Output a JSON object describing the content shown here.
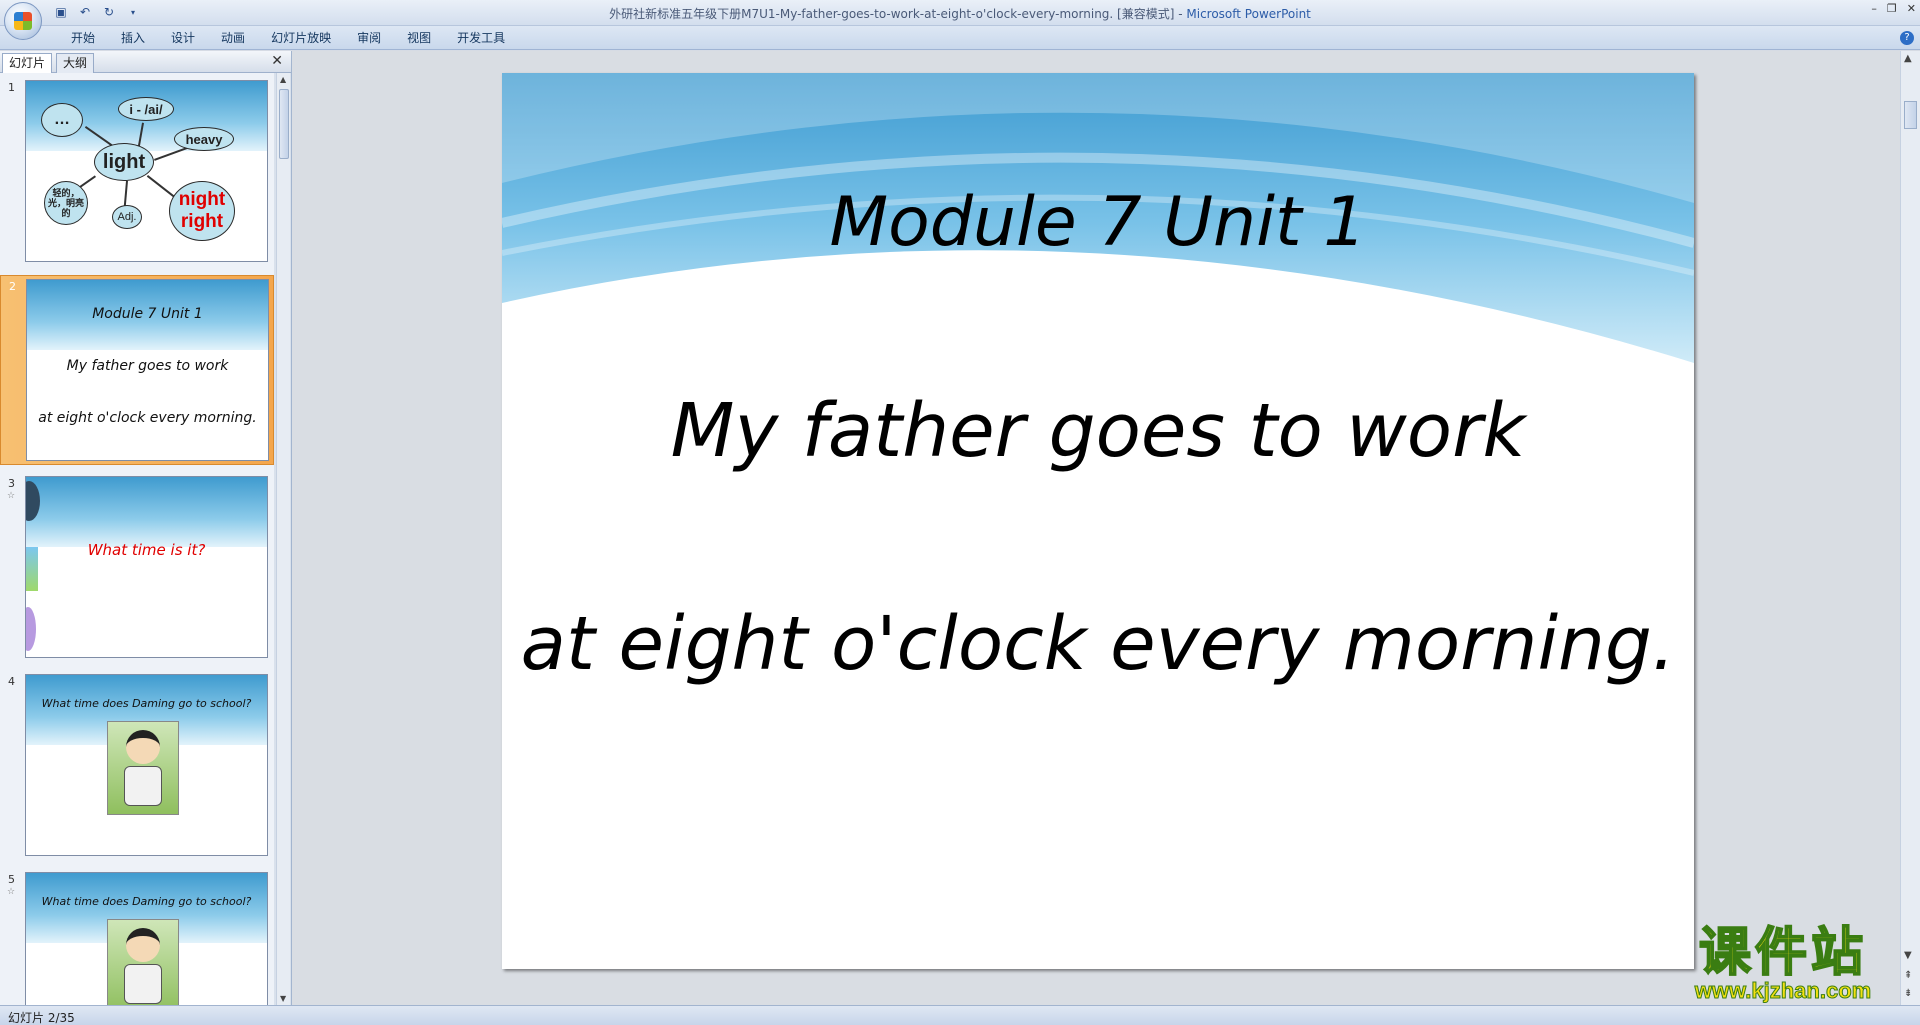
{
  "window": {
    "title": "外研社新标准五年级下册M7U1-My-father-goes-to-work-at-eight-o'clock-every-morning. [兼容模式]",
    "app_name": "Microsoft PowerPoint"
  },
  "ribbon": {
    "tabs": [
      "开始",
      "插入",
      "设计",
      "动画",
      "幻灯片放映",
      "审阅",
      "视图",
      "开发工具"
    ]
  },
  "pane": {
    "tabs": [
      "幻灯片",
      "大纲"
    ],
    "close": "✕"
  },
  "thumbnails": [
    {
      "number": "1",
      "mindmap": {
        "center": "light",
        "ellipsis": "…",
        "phonetic": "i - /ai/",
        "heavy": "heavy",
        "chinese": "轻的，光，明亮的",
        "adj": "Adj.",
        "rhymes": [
          "night",
          "right"
        ]
      }
    },
    {
      "number": "2",
      "lines": [
        "Module 7 Unit 1",
        "My father goes to work",
        "at eight o'clock every morning."
      ]
    },
    {
      "number": "3",
      "star": "☆",
      "lines": [
        "What time is it?"
      ]
    },
    {
      "number": "4",
      "lines": [
        "What time does Daming go to school?"
      ]
    },
    {
      "number": "5",
      "star": "☆",
      "lines": [
        "What time does Daming go to school?"
      ]
    }
  ],
  "slide": {
    "title": "Module 7 Unit 1",
    "line1": "My father goes to work",
    "line2": "at eight o'clock every morning."
  },
  "status": {
    "slide_counter": "幻灯片 2/35"
  },
  "watermark": {
    "text": "课件站",
    "url": "www.kjzhan.com"
  },
  "colors": {
    "accent_red": "#e00000",
    "selected_thumb": "#f4a64c"
  }
}
